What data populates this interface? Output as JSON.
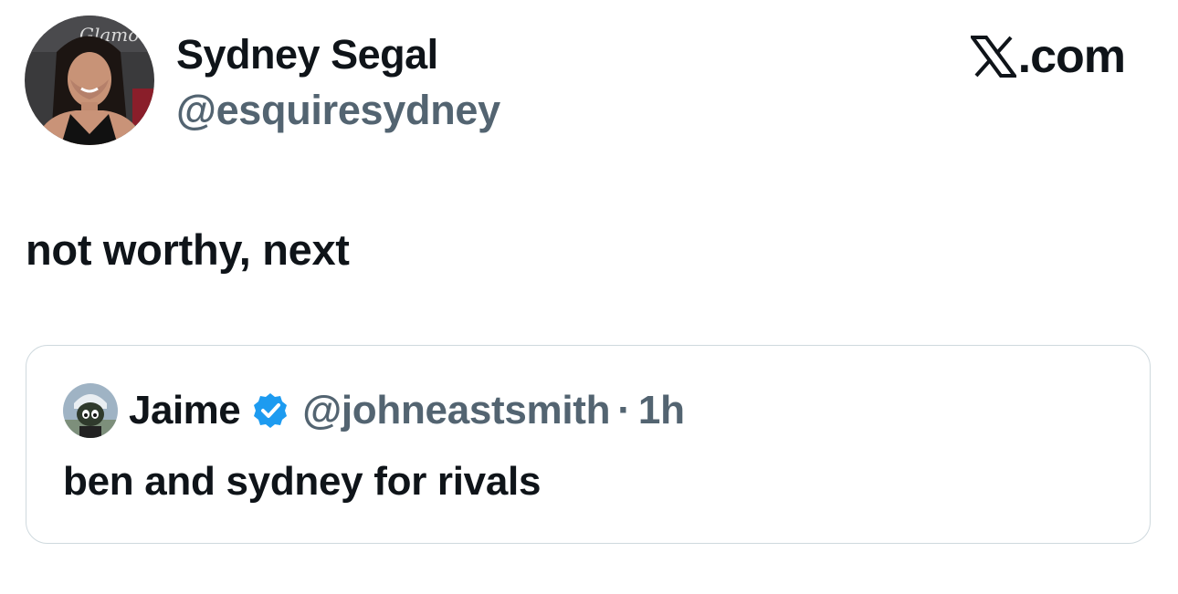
{
  "author": {
    "name": "Sydney Segal",
    "handle": "@esquiresydney",
    "avatar_icon": "profile-photo-avatar"
  },
  "brand": {
    "logo_icon": "x-logo-icon",
    "text": ".com"
  },
  "tweet": {
    "text": "not worthy, next"
  },
  "quoted_tweet": {
    "author_name": "Jaime",
    "verified_icon": "verified-badge-icon",
    "handle": "@johneastsmith",
    "separator": "·",
    "time": "1h",
    "text": "ben and sydney for rivals"
  },
  "colors": {
    "text": "#0f1419",
    "secondary_text": "#536471",
    "verified": "#1d9bf0",
    "border": "#cfd9de",
    "background": "#ffffff"
  }
}
